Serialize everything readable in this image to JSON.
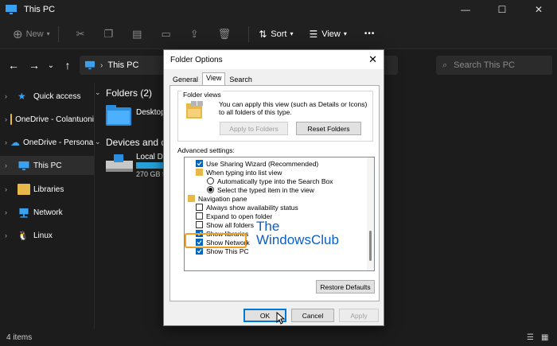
{
  "window": {
    "title": "This PC"
  },
  "toolbar": {
    "new_label": "New",
    "sort_label": "Sort",
    "view_label": "View",
    "more_label": "•••"
  },
  "address": {
    "path": "This PC",
    "search_placeholder": "Search This PC"
  },
  "sidebar": {
    "items": [
      {
        "label": "Quick access"
      },
      {
        "label": "OneDrive - Colantuoni"
      },
      {
        "label": "OneDrive - Personal"
      },
      {
        "label": "This PC"
      },
      {
        "label": "Libraries"
      },
      {
        "label": "Network"
      },
      {
        "label": "Linux"
      }
    ]
  },
  "main": {
    "folders_header": "Folders (2)",
    "folder_desktop": "Desktop",
    "devices_header": "Devices and dr",
    "disk_label": "Local Dis",
    "disk_free": "270 GB fr"
  },
  "status": {
    "items_count": "4 items"
  },
  "dialog": {
    "title": "Folder Options",
    "close_glyph": "✕",
    "tabs": [
      "General",
      "View",
      "Search"
    ],
    "folder_views_label": "Folder views",
    "folder_views_desc": "You can apply this view (such as Details or Icons) to all folders of this type.",
    "apply_to_folders": "Apply to Folders",
    "reset_folders": "Reset Folders",
    "advanced_label": "Advanced settings:",
    "tree": [
      {
        "label": "Use Sharing Wizard (Recommended)"
      },
      {
        "label": "When typing into list view"
      },
      {
        "label": "Automatically type into the Search Box"
      },
      {
        "label": "Select the typed item in the view"
      },
      {
        "label": "Navigation pane"
      },
      {
        "label": "Always show availability status"
      },
      {
        "label": "Expand to open folder"
      },
      {
        "label": "Show all folders"
      },
      {
        "label": "Show libraries"
      },
      {
        "label": "Show Network"
      },
      {
        "label": "Show This PC"
      }
    ],
    "restore_defaults": "Restore Defaults",
    "ok": "OK",
    "cancel": "Cancel",
    "apply": "Apply"
  },
  "watermark": {
    "line1": "The",
    "line2": "WindowsClub"
  },
  "colors": {
    "accent": "#0067c0",
    "highlight": "#f0a01e",
    "watermark": "#0b5fc4"
  }
}
